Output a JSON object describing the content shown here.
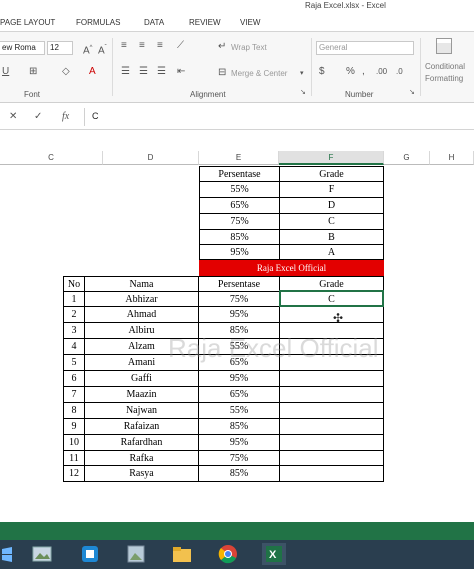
{
  "window": {
    "title": "Raja Excel.xlsx - Excel"
  },
  "ribbon_tabs": [
    "PAGE LAYOUT",
    "FORMULAS",
    "DATA",
    "REVIEW",
    "VIEW"
  ],
  "ribbon": {
    "font_name": "ew Roma",
    "font_size": "12",
    "wrap_text": "Wrap Text",
    "merge_center": "Merge & Center",
    "number_format": "General",
    "conditional_line1": "Conditional",
    "conditional_line2": "Formatting",
    "group_font": "Font",
    "group_alignment": "Alignment",
    "group_number": "Number"
  },
  "formula_bar": {
    "value": "C"
  },
  "columns": [
    "C",
    "D",
    "E",
    "F",
    "G",
    "H"
  ],
  "grade_table": {
    "header": [
      "Persentase",
      "Grade"
    ],
    "rows": [
      [
        "55%",
        "F"
      ],
      [
        "65%",
        "D"
      ],
      [
        "75%",
        "C"
      ],
      [
        "85%",
        "B"
      ],
      [
        "95%",
        "A"
      ]
    ]
  },
  "banner": "Raja Excel Official",
  "main_table": {
    "header": [
      "No",
      "Nama",
      "Persentase",
      "Grade"
    ],
    "rows": [
      [
        "1",
        "Abhizar",
        "75%",
        "C"
      ],
      [
        "2",
        "Ahmad",
        "95%",
        ""
      ],
      [
        "3",
        "Albiru",
        "85%",
        ""
      ],
      [
        "4",
        "Alzam",
        "55%",
        ""
      ],
      [
        "5",
        "Amani",
        "65%",
        ""
      ],
      [
        "6",
        "Gaffi",
        "95%",
        ""
      ],
      [
        "7",
        "Maazin",
        "65%",
        ""
      ],
      [
        "8",
        "Najwan",
        "55%",
        ""
      ],
      [
        "9",
        "Rafaizan",
        "85%",
        ""
      ],
      [
        "10",
        "Rafardhan",
        "95%",
        ""
      ],
      [
        "11",
        "Rafka",
        "75%",
        ""
      ],
      [
        "12",
        "Rasya",
        "85%",
        ""
      ]
    ]
  },
  "watermark": "Raja Excel Official"
}
